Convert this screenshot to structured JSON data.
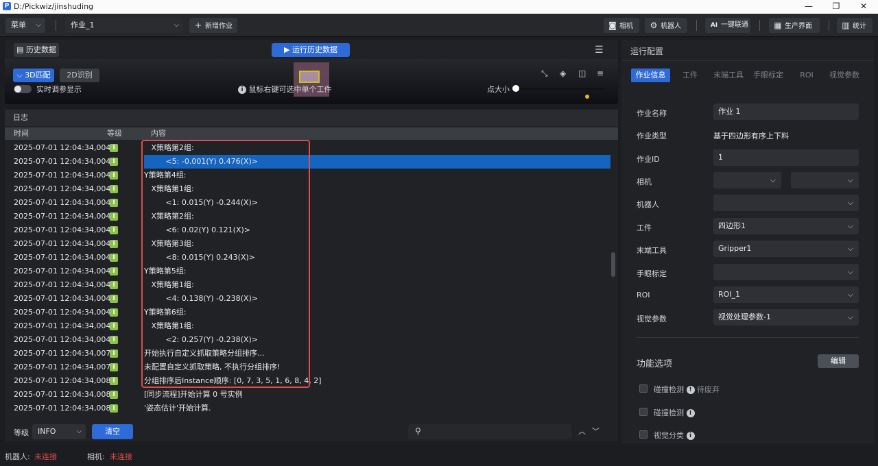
{
  "window": {
    "title": "D:/Pickwiz/jinshuding",
    "minimize": "—",
    "maximize": "❐",
    "close": "✕"
  },
  "toolbar": {
    "menu_label": "菜单",
    "job_selected": "作业_1",
    "new_job_label": "新增作业",
    "camera_label": "相机",
    "robot_label": "机器人",
    "one_click_label": "一键联通",
    "production_label": "生产界面",
    "stats_label": "统计"
  },
  "history": {
    "title": "历史数据",
    "run_button": "运行历史数据",
    "mode_3d": "3D匹配",
    "mode_2d": "2D识别",
    "realtime_label": "实时调参显示",
    "hint": "鼠标右键可选中单个工件",
    "point_size_label": "点大小"
  },
  "log": {
    "title": "日志",
    "columns": [
      "时间",
      "等级",
      "内容"
    ],
    "level_glyph": "I",
    "rows": [
      {
        "time": "2025-07-01 12:04:34,004",
        "content": "   X策略第2组:"
      },
      {
        "time": "2025-07-01 12:04:34,004",
        "content": "         <5: -0.001(Y) 0.476(X)>"
      },
      {
        "time": "2025-07-01 12:04:34,004",
        "content": "Y策略第4组:"
      },
      {
        "time": "2025-07-01 12:04:34,004",
        "content": "   X策略第1组:"
      },
      {
        "time": "2025-07-01 12:04:34,004",
        "content": "         <1: 0.015(Y) -0.244(X)>"
      },
      {
        "time": "2025-07-01 12:04:34,004",
        "content": "   X策略第2组:"
      },
      {
        "time": "2025-07-01 12:04:34,004",
        "content": "         <6: 0.02(Y) 0.121(X)>"
      },
      {
        "time": "2025-07-01 12:04:34,004",
        "content": "   X策略第3组:"
      },
      {
        "time": "2025-07-01 12:04:34,004",
        "content": "         <8: 0.015(Y) 0.243(X)>"
      },
      {
        "time": "2025-07-01 12:04:34,004",
        "content": "Y策略第5组:"
      },
      {
        "time": "2025-07-01 12:04:34,004",
        "content": "   X策略第1组:"
      },
      {
        "time": "2025-07-01 12:04:34,004",
        "content": "         <4: 0.138(Y) -0.238(X)>"
      },
      {
        "time": "2025-07-01 12:04:34,004",
        "content": "Y策略第6组:"
      },
      {
        "time": "2025-07-01 12:04:34,004",
        "content": "   X策略第1组:"
      },
      {
        "time": "2025-07-01 12:04:34,004",
        "content": "         <2: 0.257(Y) -0.238(X)>"
      },
      {
        "time": "2025-07-01 12:04:34,007",
        "content": "开始执行自定义抓取策略分组排序..."
      },
      {
        "time": "2025-07-01 12:04:34,007",
        "content": "未配置自定义抓取策略, 不执行分组排序!"
      },
      {
        "time": "2025-07-01 12:04:34,008",
        "content": "分组排序后Instance顺序: [0, 7, 3, 5, 1, 6, 8, 4, 2]"
      },
      {
        "time": "2025-07-01 12:04:34,008",
        "content": "[同步流程]开始计算 0 号实例"
      },
      {
        "time": "2025-07-01 12:04:34,008",
        "content": "'姿态估计'开始计算."
      }
    ],
    "filter_label": "等级",
    "filter_value": "INFO",
    "clear_label": "清空"
  },
  "config": {
    "title": "运行配置",
    "tabs": [
      "作业信息",
      "工件",
      "末端工具",
      "手眼标定",
      "ROI",
      "视觉参数"
    ],
    "fields": {
      "name_label": "作业名称",
      "name_value": "作业 1",
      "type_label": "作业类型",
      "type_value": "基于四边形有序上下料",
      "id_label": "作业ID",
      "id_value": "1",
      "camera_label": "相机",
      "robot_label": "机器人",
      "workpiece_label": "工件",
      "workpiece_value": "四边形1",
      "tool_label": "末端工具",
      "tool_value": "Gripper1",
      "handeye_label": "手眼标定",
      "roi_label": "ROI",
      "roi_value": "ROI_1",
      "vision_label": "视觉参数",
      "vision_value": "视觉处理参数-1"
    },
    "features_title": "功能选项",
    "edit_label": "编辑",
    "options": [
      {
        "label": "碰撞检测",
        "note": "待废弃"
      },
      {
        "label": "碰撞检测",
        "note": ""
      },
      {
        "label": "视觉分类",
        "note": ""
      }
    ]
  },
  "status": {
    "robot_label": "机器人:",
    "robot_value": "未连接",
    "camera_label": "相机:",
    "camera_value": "未连接"
  },
  "colors": {
    "accent": "#2f6bd8",
    "selected_row": "#1565c0",
    "error": "#e04b4b",
    "level_info": "#8bc34a"
  }
}
